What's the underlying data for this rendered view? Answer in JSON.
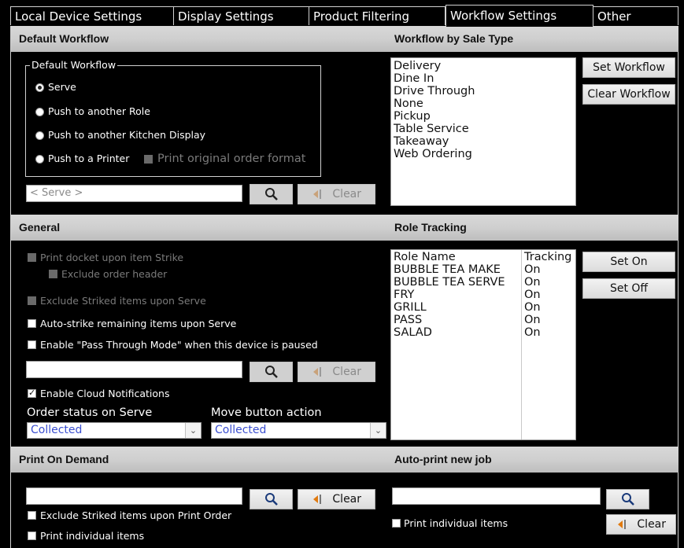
{
  "tabs": [
    "Local Device Settings",
    "Display Settings",
    "Product Filtering",
    "Workflow Settings",
    "Other"
  ],
  "active_tab": "Workflow Settings",
  "sections": {
    "default_workflow": "Default Workflow",
    "workflow_by_sale_type": "Workflow by Sale Type",
    "general": "General",
    "role_tracking": "Role Tracking",
    "print_on_demand": "Print On Demand",
    "auto_print": "Auto-print new job"
  },
  "default_workflow": {
    "group_label": "Default Workflow",
    "options": [
      "Serve",
      "Push to another Role",
      "Push to another Kitchen Display",
      "Push to a Printer"
    ],
    "selected": "Serve",
    "print_original_label": "Print original order format",
    "input_value": "< Serve >",
    "clear_label": "Clear"
  },
  "sale_types": {
    "items": [
      "Delivery",
      "Dine In",
      "Drive Through",
      "None",
      "Pickup",
      "Table Service",
      "Takeaway",
      "Web Ordering"
    ],
    "set_label": "Set Workflow",
    "clear_label": "Clear Workflow"
  },
  "general": {
    "print_docket_label": "Print docket upon item Strike",
    "exclude_header_label": "Exclude order header",
    "exclude_striked_label": "Exclude Striked items upon Serve",
    "auto_strike_label": "Auto-strike remaining items upon Serve",
    "pass_through_label": "Enable \"Pass Through Mode\" when this device is paused",
    "clear_label": "Clear",
    "cloud_label": "Enable Cloud Notifications",
    "order_status_label": "Order status on Serve",
    "order_status_value": "Collected",
    "move_action_label": "Move button action",
    "move_action_value": "Collected"
  },
  "role_tracking": {
    "col_role": "Role Name",
    "col_tracking": "Tracking",
    "rows": [
      {
        "role": "BUBBLE TEA MAKE",
        "tracking": "On"
      },
      {
        "role": "BUBBLE TEA SERVE",
        "tracking": "On"
      },
      {
        "role": "FRY",
        "tracking": "On"
      },
      {
        "role": "GRILL",
        "tracking": "On"
      },
      {
        "role": "PASS",
        "tracking": "On"
      },
      {
        "role": "SALAD",
        "tracking": "On"
      }
    ],
    "set_on_label": "Set On",
    "set_off_label": "Set Off"
  },
  "print_on_demand": {
    "clear_label": "Clear",
    "exclude_striked_label": "Exclude Striked items upon Print Order",
    "print_individual_label": "Print individual items"
  },
  "auto_print": {
    "print_individual_label": "Print individual items",
    "clear_label": "Clear"
  },
  "colors": {
    "bar": "#cfcfcf",
    "select_text": "#3b4fd0",
    "clear_arrow": "#e07a10"
  }
}
